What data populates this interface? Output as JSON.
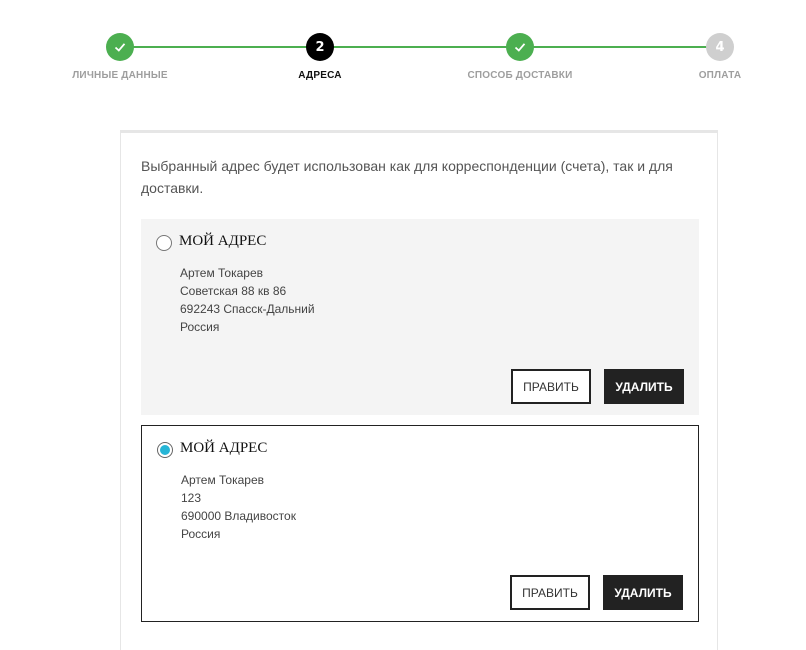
{
  "stepper": {
    "steps": [
      {
        "number": "1",
        "label": "ЛИЧНЫЕ ДАННЫЕ",
        "state": "done",
        "icon": "check-icon"
      },
      {
        "number": "2",
        "label": "АДРЕСА",
        "state": "current"
      },
      {
        "number": "3",
        "label": "СПОСОБ ДОСТАВКИ",
        "state": "done",
        "icon": "check-icon"
      },
      {
        "number": "4",
        "label": "ОПЛАТА",
        "state": "pending"
      }
    ],
    "colors": {
      "done": "#4caf50",
      "current": "#000000",
      "pending": "#cfcfcf"
    }
  },
  "intro_text": "Выбранный адрес будет использован как для корреспонденции (счета), так и для доставки.",
  "addresses": [
    {
      "title": "МОЙ АДРЕС",
      "selected": false,
      "lines": [
        "Артем Токарев",
        "Советская 88 кв 86",
        "692243 Спасск-Дальний",
        "Россия"
      ],
      "edit_label": "ПРАВИТЬ",
      "delete_label": "УДАЛИТЬ"
    },
    {
      "title": "МОЙ АДРЕС",
      "selected": true,
      "lines": [
        "Артем Токарев",
        "123",
        "690000 Владивосток",
        "Россия"
      ],
      "edit_label": "ПРАВИТЬ",
      "delete_label": "УДАЛИТЬ"
    }
  ],
  "colors": {
    "radio_selected": "#26b5d6",
    "button_dark": "#222222"
  }
}
